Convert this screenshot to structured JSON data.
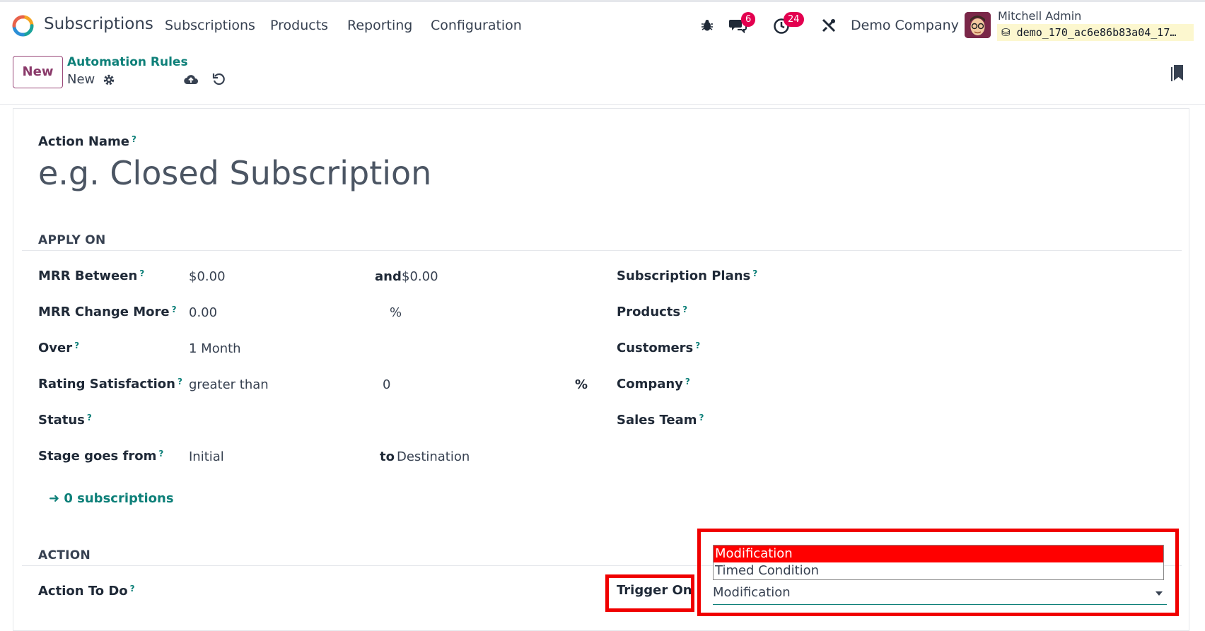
{
  "navbar": {
    "app_name": "Subscriptions",
    "menu": [
      "Subscriptions",
      "Products",
      "Reporting",
      "Configuration"
    ],
    "messages_count": "6",
    "activities_count": "24",
    "company": "Demo Company",
    "user_name": "Mitchell Admin",
    "database": "demo_170_ac6e86b83a04_17…"
  },
  "control_panel": {
    "new_label": "New",
    "breadcrumb_parent": "Automation Rules",
    "breadcrumb_current": "New"
  },
  "form": {
    "action_name_label": "Action Name",
    "action_name_placeholder": "e.g. Closed Subscription",
    "apply_on_title": "APPLY ON",
    "left_fields": [
      {
        "label": "MRR Between",
        "value": "$0.00",
        "mid_label": "and",
        "mid_value": "$0.00"
      },
      {
        "label": "MRR Change More",
        "value": "0.00",
        "mid_value": "%"
      },
      {
        "label": "Over",
        "value": "1 Month"
      },
      {
        "label": "Rating Satisfaction",
        "value": "greater than",
        "mid_value": "0",
        "unit": "%"
      },
      {
        "label": "Status"
      },
      {
        "label": "Stage goes from",
        "value": "Initial",
        "mid_label": "to",
        "mid_value": "Destination"
      }
    ],
    "right_fields": [
      "Subscription Plans",
      "Products",
      "Customers",
      "Company",
      "Sales Team"
    ],
    "subscriptions_link": "0 subscriptions",
    "action_title": "ACTION",
    "action_to_do_label": "Action To Do",
    "trigger_on_label": "Trigger On",
    "trigger_on_value": "Modification",
    "trigger_options": [
      "Modification",
      "Timed Condition"
    ]
  },
  "colors": {
    "accent": "#0e8079",
    "brand": "#8a3a6a",
    "highlight": "#f00000",
    "badge": "#e3004f"
  }
}
